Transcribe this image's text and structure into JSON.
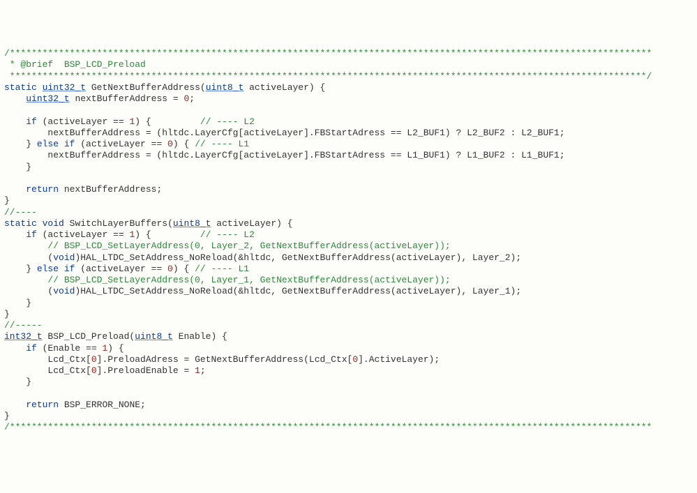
{
  "code": {
    "l01_a": "/**********************************************************************************************************************",
    "l02_a": " * @brief  BSP_LCD_Preload",
    "l03_a": " *********************************************************************************************************************/",
    "l04_a": "static",
    "l04_b": " ",
    "l04_c": "uint32_t",
    "l04_d": " GetNextBufferAddress(",
    "l04_e": "uint8_t",
    "l04_f": " activeLayer) {",
    "l05_a": "    ",
    "l05_b": "uint32_t",
    "l05_c": " nextBufferAddress = ",
    "l05_d": "0",
    "l05_e": ";",
    "l06_a": "",
    "l07_a": "    ",
    "l07_b": "if",
    "l07_c": " (activeLayer == ",
    "l07_d": "1",
    "l07_e": ") {         ",
    "l07_f": "// ---- L2",
    "l08_a": "        nextBufferAddress = (hltdc.LayerCfg[activeLayer].FBStartAdress == L2_BUF1) ? L2_BUF2 : L2_BUF1;",
    "l09_a": "    } ",
    "l09_b": "else if",
    "l09_c": " (activeLayer == ",
    "l09_d": "0",
    "l09_e": ") { ",
    "l09_f": "// ---- L1",
    "l10_a": "        nextBufferAddress = (hltdc.LayerCfg[activeLayer].FBStartAdress == L1_BUF1) ? L1_BUF2 : L1_BUF1;",
    "l11_a": "    }",
    "l12_a": "",
    "l13_a": "    ",
    "l13_b": "return",
    "l13_c": " nextBufferAddress;",
    "l14_a": "}",
    "l15_a": "//----",
    "l16_a": "static",
    "l16_b": " ",
    "l16_c": "void",
    "l16_d": " SwitchLayerBuffers(",
    "l16_e": "uint8_t",
    "l16_f": " activeLayer) {",
    "l17_a": "    ",
    "l17_b": "if",
    "l17_c": " (activeLayer == ",
    "l17_d": "1",
    "l17_e": ") {         ",
    "l17_f": "// ---- L2",
    "l18_a": "        ",
    "l18_b": "// BSP_LCD_SetLayerAddress(0, Layer_2, GetNextBufferAddress(activeLayer));",
    "l19_a": "        (",
    "l19_b": "void",
    "l19_c": ")HAL_LTDC_SetAddress_NoReload(&hltdc, GetNextBufferAddress(activeLayer), Layer_2);",
    "l20_a": "    } ",
    "l20_b": "else if",
    "l20_c": " (activeLayer == ",
    "l20_d": "0",
    "l20_e": ") { ",
    "l20_f": "// ---- L1",
    "l21_a": "        ",
    "l21_b": "// BSP_LCD_SetLayerAddress(0, Layer_1, GetNextBufferAddress(activeLayer));",
    "l22_a": "        (",
    "l22_b": "void",
    "l22_c": ")HAL_LTDC_SetAddress_NoReload(&hltdc, GetNextBufferAddress(activeLayer), Layer_1);",
    "l23_a": "    }",
    "l24_a": "}",
    "l25_a": "//-----",
    "l26_a": "int32_t",
    "l26_b": " BSP_LCD_Preload(",
    "l26_c": "uint8_t",
    "l26_d": " Enable) {",
    "l27_a": "    ",
    "l27_b": "if",
    "l27_c": " (Enable == ",
    "l27_d": "1",
    "l27_e": ") {",
    "l28_a": "        Lcd_Ctx[",
    "l28_b": "0",
    "l28_c": "].PreloadAdress = GetNextBufferAddress(Lcd_Ctx[",
    "l28_d": "0",
    "l28_e": "].ActiveLayer);",
    "l29_a": "        Lcd_Ctx[",
    "l29_b": "0",
    "l29_c": "].PreloadEnable = ",
    "l29_d": "1",
    "l29_e": ";",
    "l30_a": "    }",
    "l31_a": "",
    "l32_a": "    ",
    "l32_b": "return",
    "l32_c": " BSP_ERROR_NONE;",
    "l33_a": "}",
    "l34_a": "/**********************************************************************************************************************"
  }
}
